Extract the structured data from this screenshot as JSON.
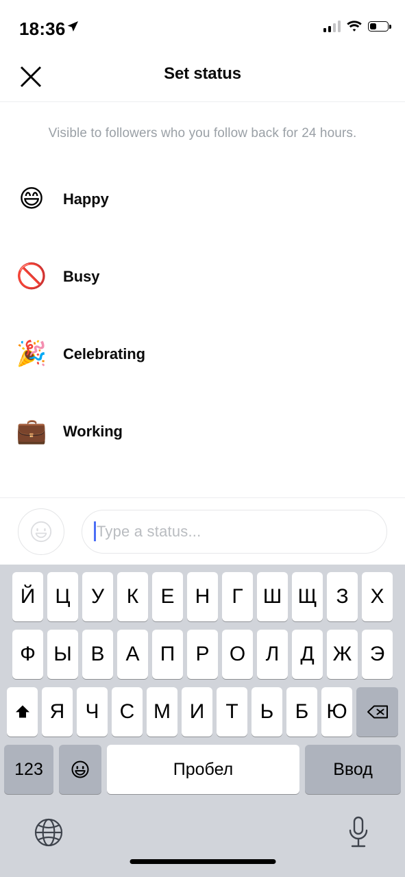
{
  "status_bar": {
    "time": "18:36",
    "location_icon": "location-arrow-icon",
    "signal_icon": "cellular-signal-icon",
    "signal_bars_filled": 2,
    "signal_bars_total": 4,
    "wifi_icon": "wifi-icon",
    "battery_icon": "battery-icon",
    "battery_level_percent": 35
  },
  "navbar": {
    "close_icon": "close-x-icon",
    "title": "Set status"
  },
  "subtitle": "Visible to followers who you follow back for 24 hours.",
  "statuses": [
    {
      "emoji": "😄",
      "emoji_name": "grinning-face-with-smiling-eyes",
      "label": "Happy"
    },
    {
      "emoji": "🚫",
      "emoji_name": "prohibited-sign",
      "label": "Busy"
    },
    {
      "emoji": "🎉",
      "emoji_name": "party-popper",
      "label": "Celebrating"
    },
    {
      "emoji": "💼",
      "emoji_name": "briefcase",
      "label": "Working"
    }
  ],
  "composer": {
    "emoji_button_icon": "smiley-face-icon",
    "placeholder": "Type a status...",
    "value": ""
  },
  "keyboard": {
    "language": "Russian",
    "row1": [
      "Й",
      "Ц",
      "У",
      "К",
      "Е",
      "Н",
      "Г",
      "Ш",
      "Щ",
      "З",
      "Х"
    ],
    "row2": [
      "Ф",
      "Ы",
      "В",
      "А",
      "П",
      "Р",
      "О",
      "Л",
      "Д",
      "Ж",
      "Э"
    ],
    "row3_letters": [
      "Я",
      "Ч",
      "С",
      "М",
      "И",
      "Т",
      "Ь",
      "Б",
      "Ю"
    ],
    "shift_icon": "shift-up-arrow-icon",
    "backspace_icon": "backspace-delete-icon",
    "numeric_label": "123",
    "emoji_key_icon": "emoji-smiley-icon",
    "space_label": "Пробел",
    "enter_label": "Ввод",
    "globe_icon": "globe-language-icon",
    "mic_icon": "microphone-icon"
  },
  "colors": {
    "keyboard_background": "#d1d4da",
    "key_white": "#ffffff",
    "key_gray": "#aeb3bd",
    "caret_blue": "#4b6ef5",
    "subtitle_gray": "#9aa0a6",
    "placeholder_gray": "#b9bcc0"
  }
}
